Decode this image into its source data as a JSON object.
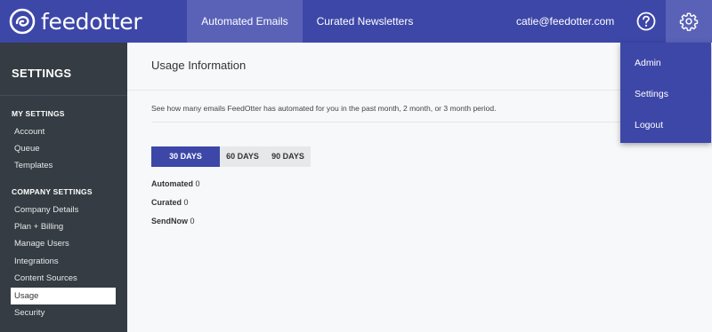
{
  "brand": {
    "name": "feedotter",
    "primary_color": "#3d47a8",
    "accent_color": "#5a62b8",
    "sidebar_color": "#353c43"
  },
  "topnav": {
    "tabs": [
      {
        "label": "Automated Emails",
        "active": true
      },
      {
        "label": "Curated Newsletters",
        "active": false
      }
    ],
    "user_email": "catie@feedotter.com",
    "help_icon": "question-circle-icon",
    "settings_icon": "gear-icon"
  },
  "dropdown": {
    "items": [
      {
        "label": "Admin"
      },
      {
        "label": "Settings"
      },
      {
        "label": "Logout"
      }
    ]
  },
  "sidebar": {
    "title": "SETTINGS",
    "my_settings": {
      "heading": "MY SETTINGS",
      "items": [
        {
          "label": "Account"
        },
        {
          "label": "Queue"
        },
        {
          "label": "Templates"
        }
      ]
    },
    "company_settings": {
      "heading": "COMPANY SETTINGS",
      "items": [
        {
          "label": "Company Details"
        },
        {
          "label": "Plan + Billing"
        },
        {
          "label": "Manage Users"
        },
        {
          "label": "Integrations"
        },
        {
          "label": "Content Sources"
        },
        {
          "label": "Usage",
          "active": true
        },
        {
          "label": "Security"
        }
      ]
    }
  },
  "main": {
    "title": "Usage Information",
    "description": "See how many emails FeedOtter has automated for you in the past month, 2 month, or 3 month period.",
    "periods": [
      {
        "label": "30 DAYS",
        "active": true
      },
      {
        "label": "60 DAYS",
        "active": false
      },
      {
        "label": "90 DAYS",
        "active": false
      }
    ],
    "stats": [
      {
        "label": "Automated",
        "value": "0"
      },
      {
        "label": "Curated",
        "value": "0"
      },
      {
        "label": "SendNow",
        "value": "0"
      }
    ]
  }
}
